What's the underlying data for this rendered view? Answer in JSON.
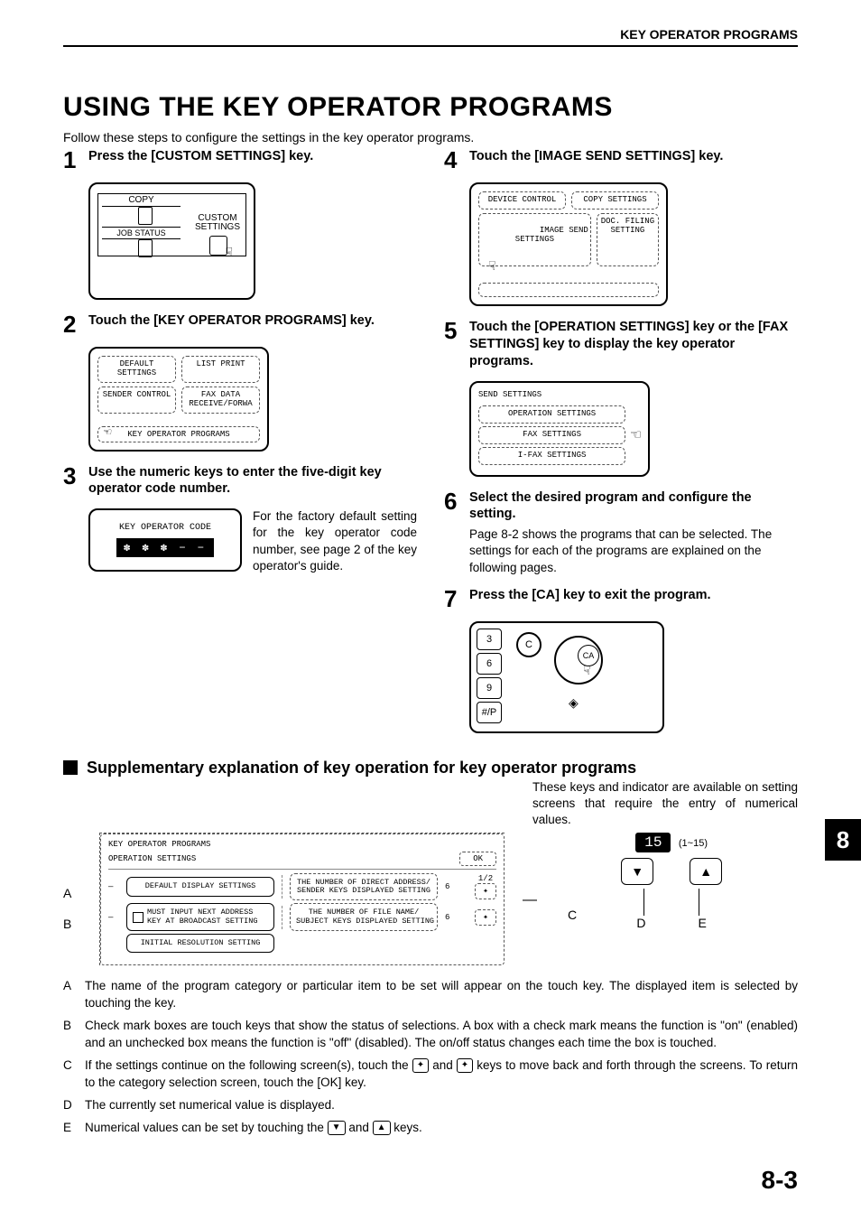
{
  "header": "KEY OPERATOR PROGRAMS",
  "title": "USING THE KEY OPERATOR PROGRAMS",
  "intro": "Follow these steps to configure the settings in the key operator programs.",
  "steps": {
    "s1": {
      "num": "1",
      "title": "Press the [CUSTOM SETTINGS] key."
    },
    "s2": {
      "num": "2",
      "title": "Touch the [KEY OPERATOR PROGRAMS] key."
    },
    "s3": {
      "num": "3",
      "title": "Use the numeric keys to enter the five-digit key operator code number.",
      "desc": "For the factory default setting for the key operator code number, see page 2 of the key operator's guide."
    },
    "s4": {
      "num": "4",
      "title": "Touch the [IMAGE SEND SETTINGS] key."
    },
    "s5": {
      "num": "5",
      "title": "Touch the [OPERATION SETTINGS] key or the [FAX SETTINGS] key to display the key operator programs."
    },
    "s6": {
      "num": "6",
      "title": "Select the desired program and configure the setting.",
      "desc": "Page 8-2 shows the programs that can be selected. The settings for each of the programs are explained on the following pages."
    },
    "s7": {
      "num": "7",
      "title": "Press the [CA] key to exit the program."
    }
  },
  "fig1": {
    "copy": "COPY",
    "job_status": "JOB STATUS",
    "custom": "CUSTOM\nSETTINGS"
  },
  "fig2": {
    "default_settings": "DEFAULT\nSETTINGS",
    "list_print": "LIST PRINT",
    "sender_control": "SENDER CONTROL",
    "fax_data": "FAX DATA\nRECEIVE/FORWA",
    "kop": "KEY OPERATOR PROGRAMS"
  },
  "fig3": {
    "label": "KEY OPERATOR CODE",
    "code": "✽ ✽ ✽ − −"
  },
  "fig4": {
    "device": "DEVICE CONTROL",
    "copy": "COPY SETTINGS",
    "image_send": "IMAGE SEND\nSETTINGS",
    "doc_filing": "DOC. FILING\nSETTING"
  },
  "fig5": {
    "header": "SEND SETTINGS",
    "op": "OPERATION SETTINGS",
    "fax": "FAX SETTINGS",
    "ifax": "I-FAX SETTINGS"
  },
  "fig7": {
    "k3": "3",
    "k6": "6",
    "k9": "9",
    "kp": "#/P",
    "c": "C",
    "ca": "CA"
  },
  "section2": {
    "heading": "Supplementary explanation of key operation for key operator programs",
    "intro": "These keys and indicator are available on setting screens that require the entry of numerical values."
  },
  "bigpanel": {
    "t1": "KEY OPERATOR PROGRAMS",
    "t2": "OPERATION SETTINGS",
    "ok": "OK",
    "page": "1/2",
    "a": "DEFAULT DISPLAY SETTINGS",
    "r1": "THE NUMBER OF DIRECT ADDRESS/\nSENDER KEYS DISPLAYED SETTING",
    "r1n": "6",
    "b": "MUST INPUT NEXT ADDRESS\nKEY AT BROADCAST SETTING",
    "r2": "THE NUMBER OF FILE NAME/\nSUBJECT KEYS DISPLAYED SETTING",
    "r2n": "6",
    "c": "INITIAL RESOLUTION SETTING"
  },
  "valbox": {
    "value": "15",
    "range": "(1~15)"
  },
  "labels": {
    "A": "A",
    "B": "B",
    "C": "C",
    "D": "D",
    "E": "E"
  },
  "defs": {
    "A": "The name of the program category or particular item to be set will appear on the touch key. The displayed item is selected by touching the key.",
    "B": "Check mark boxes are touch keys that show the status of selections. A box with a check mark means the function is \"on\" (enabled) and an unchecked box means the function is \"off\" (disabled). The on/off status changes each time the box is touched.",
    "C_pre": "If the settings continue on the following screen(s), touch the ",
    "C_mid": " and ",
    "C_post": " keys to move back and forth through the screens. To return to the category selection screen, touch the [OK] key.",
    "D": "The currently set numerical value is displayed.",
    "E_pre": "Numerical values can be set by touching the ",
    "E_mid": " and ",
    "E_post": " keys."
  },
  "page_num": "8-3",
  "tab": "8"
}
